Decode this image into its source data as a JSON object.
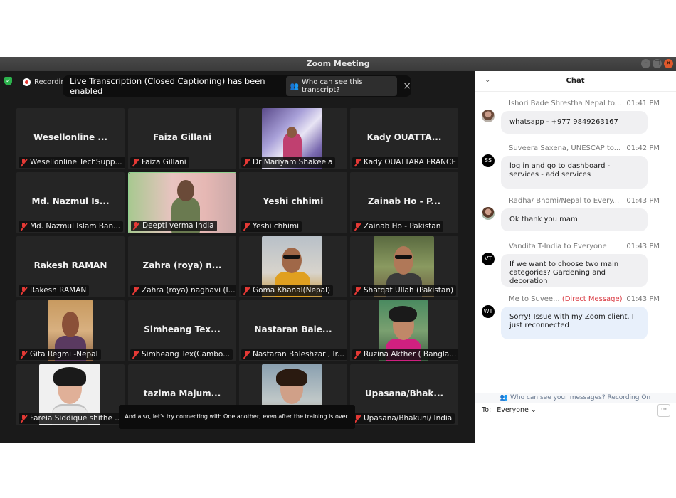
{
  "window": {
    "title": "Zoom Meeting"
  },
  "topbar": {
    "recording_label": "Recording",
    "banner_text": "Live Transcription (Closed Captioning) has been enabled",
    "banner_button": "Who can see this transcript?",
    "banner_close": "×"
  },
  "participants": [
    {
      "name": "Wesellonline ...",
      "label": "Wesellonline TechSupp..."
    },
    {
      "name": "Faiza Gillani",
      "label": "Faiza Gillani"
    },
    {
      "name": "",
      "label": "Dr Mariyam Shakeela"
    },
    {
      "name": "Kady OUATTA...",
      "label": "Kady OUATTARA FRANCE"
    },
    {
      "name": "Md. Nazmul Is...",
      "label": "Md. Nazmul Islam Ban..."
    },
    {
      "name": "",
      "label": "Deepti verma India"
    },
    {
      "name": "Yeshi chhimi",
      "label": "Yeshi chhimi"
    },
    {
      "name": "Zainab Ho - P...",
      "label": "Zainab Ho - Pakistan"
    },
    {
      "name": "Rakesh RAMAN",
      "label": "Rakesh RAMAN"
    },
    {
      "name": "Zahra (roya) n...",
      "label": "Zahra (roya) naghavi (I..."
    },
    {
      "name": "",
      "label": "Goma Khanal(Nepal)"
    },
    {
      "name": "",
      "label": "Shafqat Ullah (Pakistan)"
    },
    {
      "name": "",
      "label": "Gita Regmi -Nepal"
    },
    {
      "name": "Simheang Tex...",
      "label": "Simheang Tex(Cambo..."
    },
    {
      "name": "Nastaran Bale...",
      "label": "Nastaran Baleshzar , Ir..."
    },
    {
      "name": "",
      "label": "Ruzina Akther ( Bangla..."
    },
    {
      "name": "",
      "label": "Fareia Siddique shithe ..."
    },
    {
      "name": "tazima Majum...",
      "label": ""
    },
    {
      "name": "",
      "label": ""
    },
    {
      "name": "Upasana/Bhak...",
      "label": "Upasana/Bhakuni/ India"
    }
  ],
  "caption": "And also, let's try connecting with One another, even after the training is over.",
  "chat": {
    "title": "Chat",
    "messages": [
      {
        "sender": "Ishori Bade Shrestha Nepal to...",
        "time": "01:41 PM",
        "avatar": "",
        "text": "whatsapp - +977 9849263167"
      },
      {
        "sender": "Suveera Saxena, UNESCAP to...",
        "time": "01:42 PM",
        "avatar": "SS",
        "text": "log in and go to dashboard - services - add services"
      },
      {
        "sender": "Radha/ Bhomi/Nepal to Every...",
        "time": "01:43 PM",
        "avatar": "",
        "text": "Ok thank you mam"
      },
      {
        "sender": "Vandita T-India to Everyone",
        "time": "01:43 PM",
        "avatar": "VT",
        "text": "If we want to choose two main categories? Gardening and decoration"
      },
      {
        "sender": "Me to Suvee...",
        "dm": "(Direct Message)",
        "time": "01:43 PM",
        "avatar": "WT",
        "text": "Sorry! Issue with my Zoom client. I just reconnected"
      }
    ],
    "visibility_note": "Who can see your messages? Recording On",
    "to_label": "To:",
    "to_value": "Everyone",
    "more": "···"
  }
}
